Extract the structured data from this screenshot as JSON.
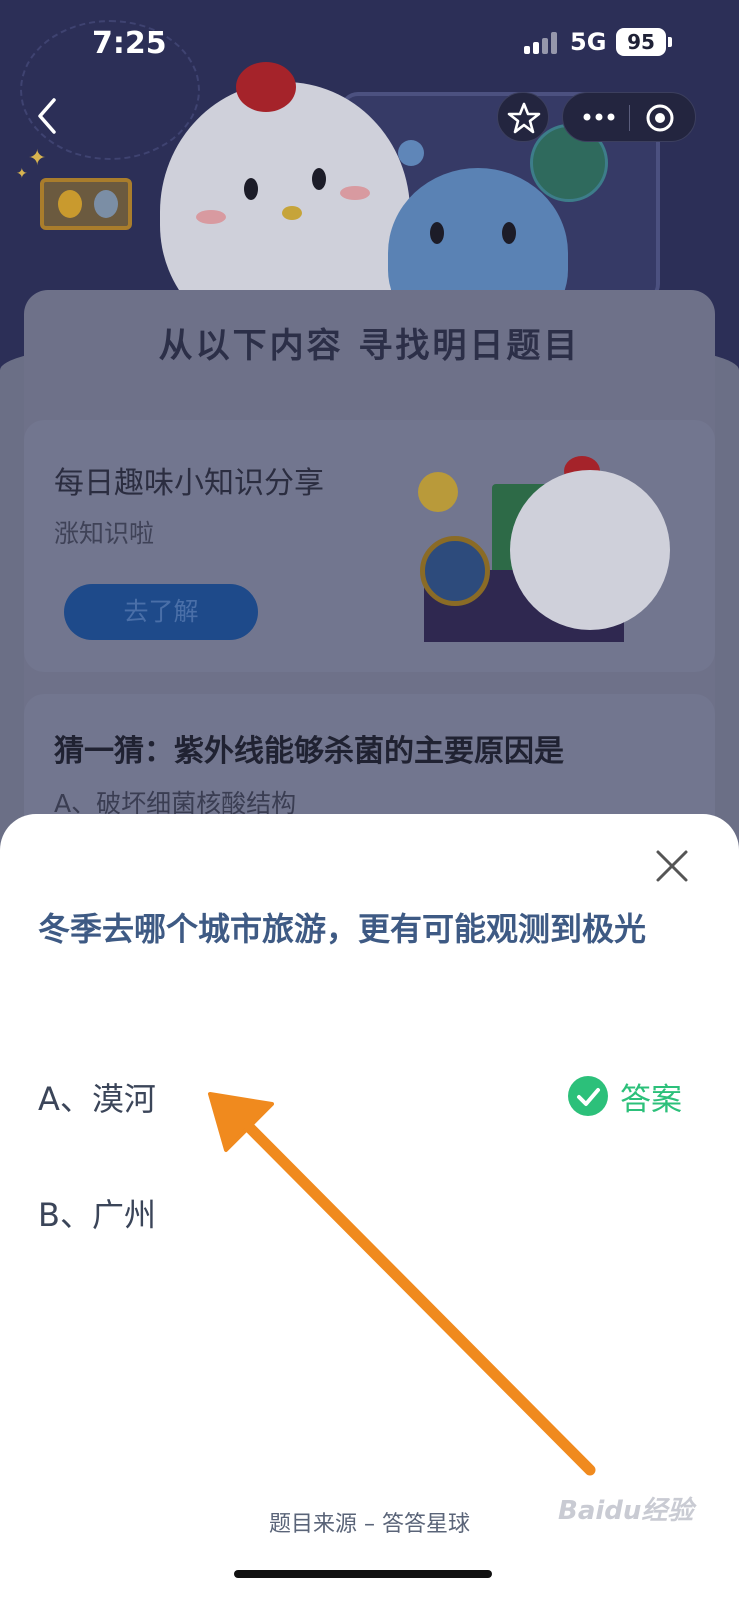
{
  "status_bar": {
    "time": "7:25",
    "network": "5G",
    "battery": "95"
  },
  "nav": {
    "back_icon": "chevron-left-icon",
    "favorite_icon": "star-icon",
    "more_icon": "more-dots-icon",
    "close_icon": "target-circle-icon"
  },
  "background": {
    "section_title": "从以下内容 寻找明日题目",
    "card1": {
      "title": "每日趣味小知识分享",
      "subtitle": "涨知识啦",
      "button": "去了解"
    },
    "card2": {
      "title": "猜一猜：紫外线能够杀菌的主要原因是",
      "option": "A、破坏细菌核酸结构"
    }
  },
  "sheet": {
    "question": "冬季去哪个城市旅游，更有可能观测到极光",
    "options": [
      {
        "label": "A、漠河",
        "is_answer": true
      },
      {
        "label": "B、广州",
        "is_answer": false
      }
    ],
    "answer_label": "答案",
    "source": "题目来源 – 答答星球"
  },
  "watermark": "Baidu经验",
  "colors": {
    "question": "#3e5a84",
    "answer_green": "#2cc07a",
    "arrow_orange": "#f08a1e"
  }
}
